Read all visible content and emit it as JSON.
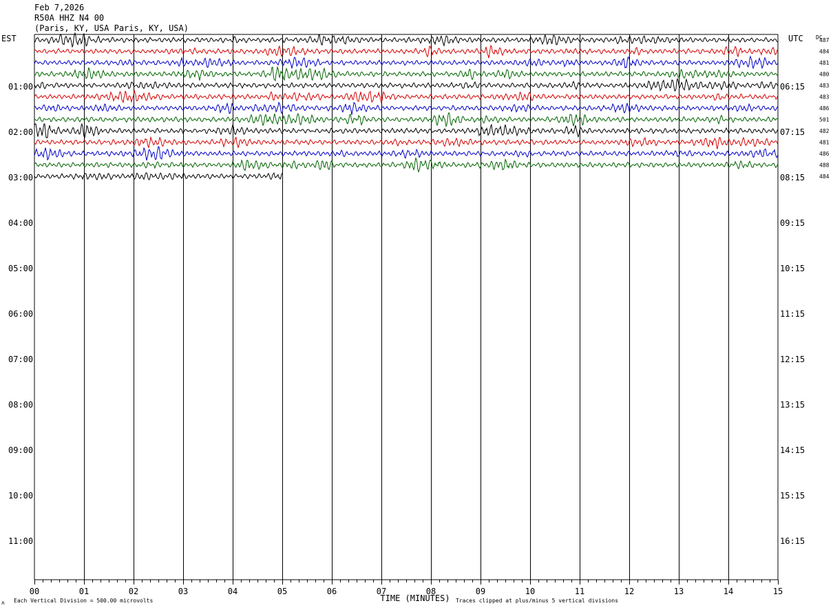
{
  "header": {
    "date": "Feb 7,2026",
    "station": "R50A HHZ N4 00",
    "location": "(Paris, KY, USA Paris, KY, USA)"
  },
  "labels": {
    "left_timezone": "EST",
    "right_timezone": "UTC",
    "dc_label": "DC",
    "xlabel": "TIME (MINUTES)",
    "footer_left": "Each Vertical Division =  500.00 microvolts",
    "footer_right": "Traces clipped at plus/minus 5 vertical divisions",
    "corner_mark": "ʌ"
  },
  "colors": {
    "trace_cycle": [
      "#000000",
      "#d40000",
      "#0000c8",
      "#006400"
    ],
    "grid": "#000000"
  },
  "chart_data": {
    "type": "line",
    "x_ticks": [
      "00",
      "01",
      "02",
      "03",
      "04",
      "05",
      "06",
      "07",
      "08",
      "09",
      "10",
      "11",
      "12",
      "13",
      "14",
      "15"
    ],
    "xlim": [
      0,
      15
    ],
    "left_hour_labels": [
      "01:00",
      "02:00",
      "03:00",
      "04:00",
      "05:00",
      "06:00",
      "07:00",
      "08:00",
      "09:00",
      "10:00",
      "11:00"
    ],
    "right_hour_labels": [
      "06:15",
      "07:15",
      "08:15",
      "09:15",
      "10:15",
      "11:15",
      "12:15",
      "13:15",
      "14:15",
      "15:15",
      "16:15"
    ],
    "rows": [
      {
        "dc": "487",
        "minutes_recorded": 15
      },
      {
        "dc": "484",
        "minutes_recorded": 15
      },
      {
        "dc": "481",
        "minutes_recorded": 15
      },
      {
        "dc": "480",
        "minutes_recorded": 15
      },
      {
        "dc": "483",
        "minutes_recorded": 15
      },
      {
        "dc": "483",
        "minutes_recorded": 15
      },
      {
        "dc": "486",
        "minutes_recorded": 15
      },
      {
        "dc": "501",
        "minutes_recorded": 15
      },
      {
        "dc": "482",
        "minutes_recorded": 15
      },
      {
        "dc": "481",
        "minutes_recorded": 15
      },
      {
        "dc": "486",
        "minutes_recorded": 15
      },
      {
        "dc": "488",
        "minutes_recorded": 15
      },
      {
        "dc": "484",
        "minutes_recorded": 5
      }
    ]
  }
}
